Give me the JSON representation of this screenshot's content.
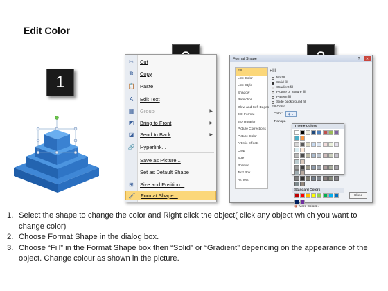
{
  "title": "Edit Color",
  "badges": [
    "1",
    "2",
    "3"
  ],
  "context_menu": {
    "items": [
      {
        "label": "Cut",
        "icon": "scissors-icon",
        "glyph": "✂",
        "disabled": false,
        "submenu": false
      },
      {
        "label": "Copy",
        "icon": "copy-icon",
        "glyph": "⧉",
        "disabled": false,
        "submenu": false
      },
      {
        "label": "Paste",
        "icon": "paste-icon",
        "glyph": "📋",
        "disabled": false,
        "submenu": false
      },
      {
        "label": "Edit Text",
        "icon": "edit-text-icon",
        "glyph": "A",
        "disabled": false,
        "submenu": false
      },
      {
        "label": "Group",
        "icon": "group-icon",
        "glyph": "▦",
        "disabled": true,
        "submenu": true
      },
      {
        "label": "Bring to Front",
        "icon": "bring-front-icon",
        "glyph": "◩",
        "disabled": false,
        "submenu": true
      },
      {
        "label": "Send to Back",
        "icon": "send-back-icon",
        "glyph": "◪",
        "disabled": false,
        "submenu": true
      },
      {
        "label": "Hyperlink...",
        "icon": "hyperlink-icon",
        "glyph": "🔗",
        "disabled": false,
        "submenu": false
      },
      {
        "label": "Save as Picture...",
        "icon": "",
        "glyph": "",
        "disabled": false,
        "submenu": false
      },
      {
        "label": "Set as Default Shape",
        "icon": "",
        "glyph": "",
        "disabled": false,
        "submenu": false
      },
      {
        "label": "Size and Position...",
        "icon": "size-position-icon",
        "glyph": "⊞",
        "disabled": false,
        "submenu": false
      },
      {
        "label": "Format Shape...",
        "icon": "format-shape-icon",
        "glyph": "🖌",
        "disabled": false,
        "submenu": false,
        "highlighted": true
      }
    ]
  },
  "dialog": {
    "title": "Format Shape",
    "categories": [
      "Fill",
      "Line Color",
      "Line Style",
      "Shadow",
      "Reflection",
      "Glow and Soft Edges",
      "3-D Format",
      "3-D Rotation",
      "Picture Corrections",
      "Picture Color",
      "Artistic Effects",
      "Crop",
      "Size",
      "Position",
      "Text Box",
      "Alt Text"
    ],
    "selected_category": "Fill",
    "pane_heading": "Fill",
    "fill_options": [
      {
        "label": "No fill",
        "checked": false
      },
      {
        "label": "Solid fill",
        "checked": true
      },
      {
        "label": "Gradient fill",
        "checked": false
      },
      {
        "label": "Picture or texture fill",
        "checked": false
      },
      {
        "label": "Pattern fill",
        "checked": false
      },
      {
        "label": "Slide background fill",
        "checked": false
      }
    ],
    "fill_color_label": "Fill Color",
    "color_label": "Color:",
    "transparency_label": "Transpa",
    "close_label": "Close",
    "palette": {
      "theme_label": "Theme Colors",
      "standard_label": "Standard Colors",
      "more_label": "More Colors...",
      "theme_top": [
        "#ffffff",
        "#000000",
        "#eeece1",
        "#1f497d",
        "#4f81bd",
        "#c0504d",
        "#9bbb59",
        "#8064a2",
        "#4bacc6",
        "#f79646"
      ],
      "theme_shades": [
        "#d8d8d8",
        "#595959",
        "#ddd9c3",
        "#c6d9f0",
        "#dbe5f1",
        "#f2dcdb",
        "#ebf1dd",
        "#e5e0ec",
        "#dbeef3",
        "#fdeada"
      ],
      "standard": [
        "#c00000",
        "#ff0000",
        "#ffc000",
        "#ffff00",
        "#92d050",
        "#00b050",
        "#00b0f0",
        "#0070c0",
        "#002060",
        "#7030a0"
      ]
    }
  },
  "instructions": [
    {
      "n": "1.",
      "text": "Select the shape to change the color and Right click the object( click any object which you want to change color)"
    },
    {
      "n": "2.",
      "text": "Choose Format Shape in the dialog box."
    },
    {
      "n": "3.",
      "text": "Choose “Fill” in the Format Shape box then “Solid” or “Gradient” depending on the appearance of the object. Change colour as shown in the picture."
    }
  ]
}
